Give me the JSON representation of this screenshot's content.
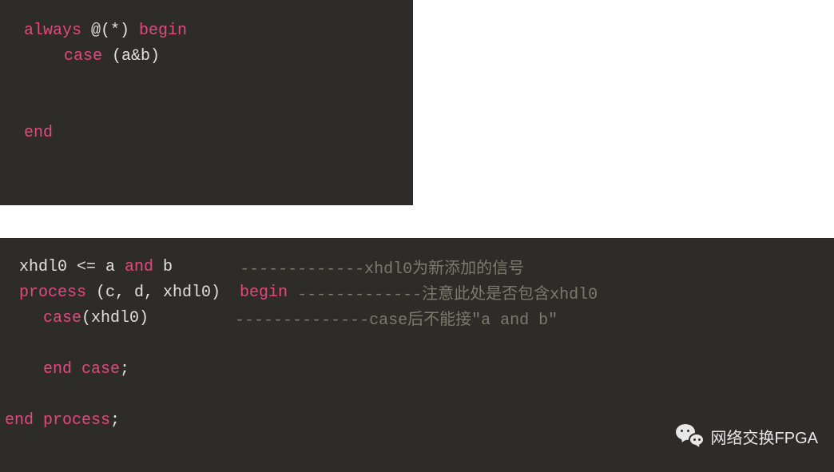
{
  "block1": {
    "lines": [
      {
        "indent": 0,
        "tokens": [
          {
            "text": "always",
            "cls": "keyword"
          },
          {
            "text": " @(*) ",
            "cls": "identifier"
          },
          {
            "text": "begin",
            "cls": "keyword"
          }
        ]
      },
      {
        "indent": 1,
        "active": true,
        "tokens": [
          {
            "text": "case",
            "cls": "keyword"
          },
          {
            "text": " (a&b)",
            "cls": "identifier"
          }
        ]
      },
      {
        "blank": true
      },
      {
        "blank": true
      },
      {
        "indent": 0,
        "tokens": [
          {
            "text": "end",
            "cls": "keyword"
          }
        ]
      }
    ]
  },
  "block2": {
    "lines": [
      {
        "indent": 0,
        "tokens": [
          {
            "text": "xhdl0 <= a ",
            "cls": "identifier"
          },
          {
            "text": "and",
            "cls": "keyword"
          },
          {
            "text": " b",
            "cls": "identifier"
          },
          {
            "text": "       -------------xhdl0为新添加的信号",
            "cls": "comment"
          }
        ]
      },
      {
        "indent": 0,
        "tokens": [
          {
            "text": "process",
            "cls": "keyword"
          },
          {
            "text": " (c, d, xhdl0)  ",
            "cls": "identifier"
          },
          {
            "text": "begin",
            "cls": "keyword"
          },
          {
            "text": " -------------注意此处是否包含xhdl0",
            "cls": "comment"
          }
        ]
      },
      {
        "indent": 1,
        "active": true,
        "tokens": [
          {
            "text": "case",
            "cls": "keyword"
          },
          {
            "text": "(xhdl0)",
            "cls": "identifier"
          },
          {
            "text": "         --------------case后不能接\"a and b\"",
            "cls": "comment"
          }
        ]
      },
      {
        "blank": true,
        "indent": 1
      },
      {
        "indent": 1,
        "tokens": [
          {
            "text": "end",
            "cls": "keyword"
          },
          {
            "text": " ",
            "cls": "identifier"
          },
          {
            "text": "case",
            "cls": "keyword"
          },
          {
            "text": ";",
            "cls": "identifier"
          }
        ]
      },
      {
        "blank": true
      },
      {
        "indent": -1,
        "tokens": [
          {
            "text": "end",
            "cls": "keyword"
          },
          {
            "text": " ",
            "cls": "identifier"
          },
          {
            "text": "process",
            "cls": "keyword"
          },
          {
            "text": ";",
            "cls": "identifier"
          }
        ]
      }
    ]
  },
  "watermark": {
    "label": "网络交换FPGA"
  }
}
